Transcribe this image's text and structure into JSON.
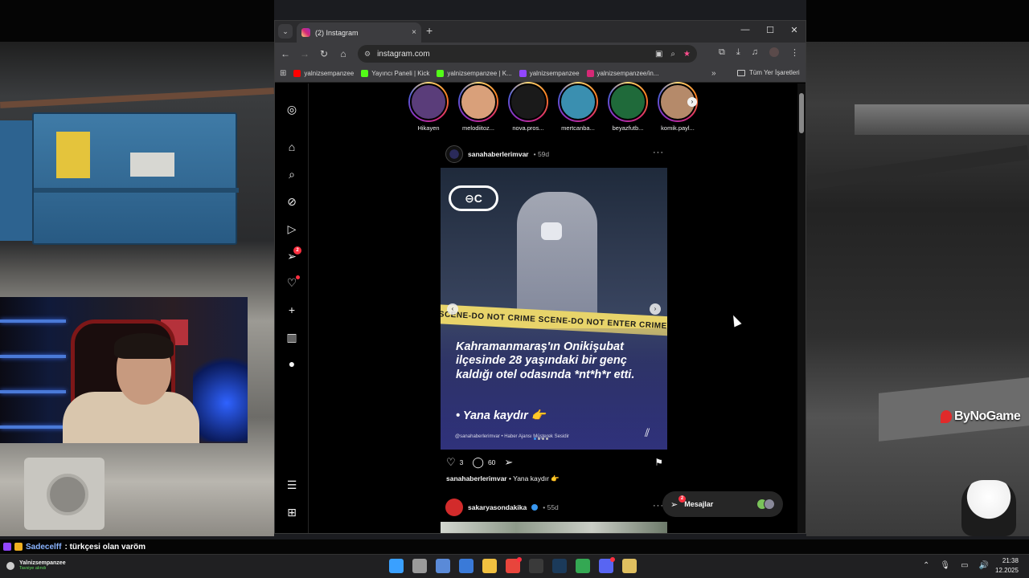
{
  "browser": {
    "tab_title": "(2) Instagram",
    "tab_close": "×",
    "new_tab": "+",
    "url": "instagram.com",
    "window_controls": [
      "—",
      "☐",
      "✕"
    ],
    "bookmarks": [
      {
        "label": "yalnizsempanzee",
        "color": "#ff0000"
      },
      {
        "label": "Yayıncı Paneli | Kick",
        "color": "#53fc18"
      },
      {
        "label": "yalnizsempanzee | K...",
        "color": "#53fc18"
      },
      {
        "label": "yalnizsempanzee",
        "color": "#9146ff"
      },
      {
        "label": "yalnizsempanzee/in...",
        "color": "#d62976"
      }
    ],
    "bookmarks_more": "»",
    "all_bookmarks": "Tüm Yer İşaretleri"
  },
  "instagram": {
    "nav_badges": {
      "messages": "2"
    },
    "stories": [
      {
        "name": "Hikayen",
        "color": "#5a3d7a"
      },
      {
        "name": "melodiitoz...",
        "color": "#d9a07a"
      },
      {
        "name": "nova.pros...",
        "color": "#1a1a1a"
      },
      {
        "name": "mertcanba...",
        "color": "#3a8fb0"
      },
      {
        "name": "beyazfutb...",
        "color": "#1f6a3a"
      },
      {
        "name": "komik.payl...",
        "color": "#b58a6a"
      }
    ],
    "post1": {
      "username": "sanahaberlerimvar",
      "time": "• 59d",
      "logo_text": "⊖C",
      "tape_text": "SCENE-DO NOT  CRIME SCENE-DO NOT ENTER  CRIME S",
      "headline": "Kahramanmaraş'ın Onikişubat ilçesinde 28 yaşındaki bir genç kaldığı otel odasında *nt*h*r etti.",
      "swipe_text": "• Yana kaydır 👉",
      "footer_text": "@sanahaberlerimvar  •  Haber Ajansı Müşterek Sesidir",
      "likes": "3",
      "comments": "60",
      "caption_user": "sanahaberlerimvar",
      "caption_text": "• Yana kaydır 👉"
    },
    "post2": {
      "username": "sakaryasondakika",
      "time": "• 55d"
    },
    "messages_label": "Mesajlar",
    "messages_badge": "2"
  },
  "stream": {
    "chat_user": "Sadecelff",
    "chat_message": ": türkçesi olan varöm",
    "watermark": "ByNoGame"
  },
  "taskbar": {
    "user_name": "Yalnizsempanzee",
    "user_sub": "Tavsiye alındı",
    "clock_time": "21:38",
    "clock_date": "12.2025",
    "apps": [
      {
        "name": "windows-start",
        "color": "#3aa0ff"
      },
      {
        "name": "task-view",
        "color": "#9a9a9a"
      },
      {
        "name": "photos",
        "color": "#5a8ad8"
      },
      {
        "name": "store",
        "color": "#3a7ad8"
      },
      {
        "name": "file-explorer",
        "color": "#f0c040"
      },
      {
        "name": "chrome",
        "color": "#e8453c"
      },
      {
        "name": "obs",
        "color": "#3a3a3a"
      },
      {
        "name": "steam",
        "color": "#1b3a5a"
      },
      {
        "name": "chrome-2",
        "color": "#34a853"
      },
      {
        "name": "discord",
        "color": "#5865f2"
      },
      {
        "name": "media-player",
        "color": "#e0c060"
      }
    ]
  }
}
